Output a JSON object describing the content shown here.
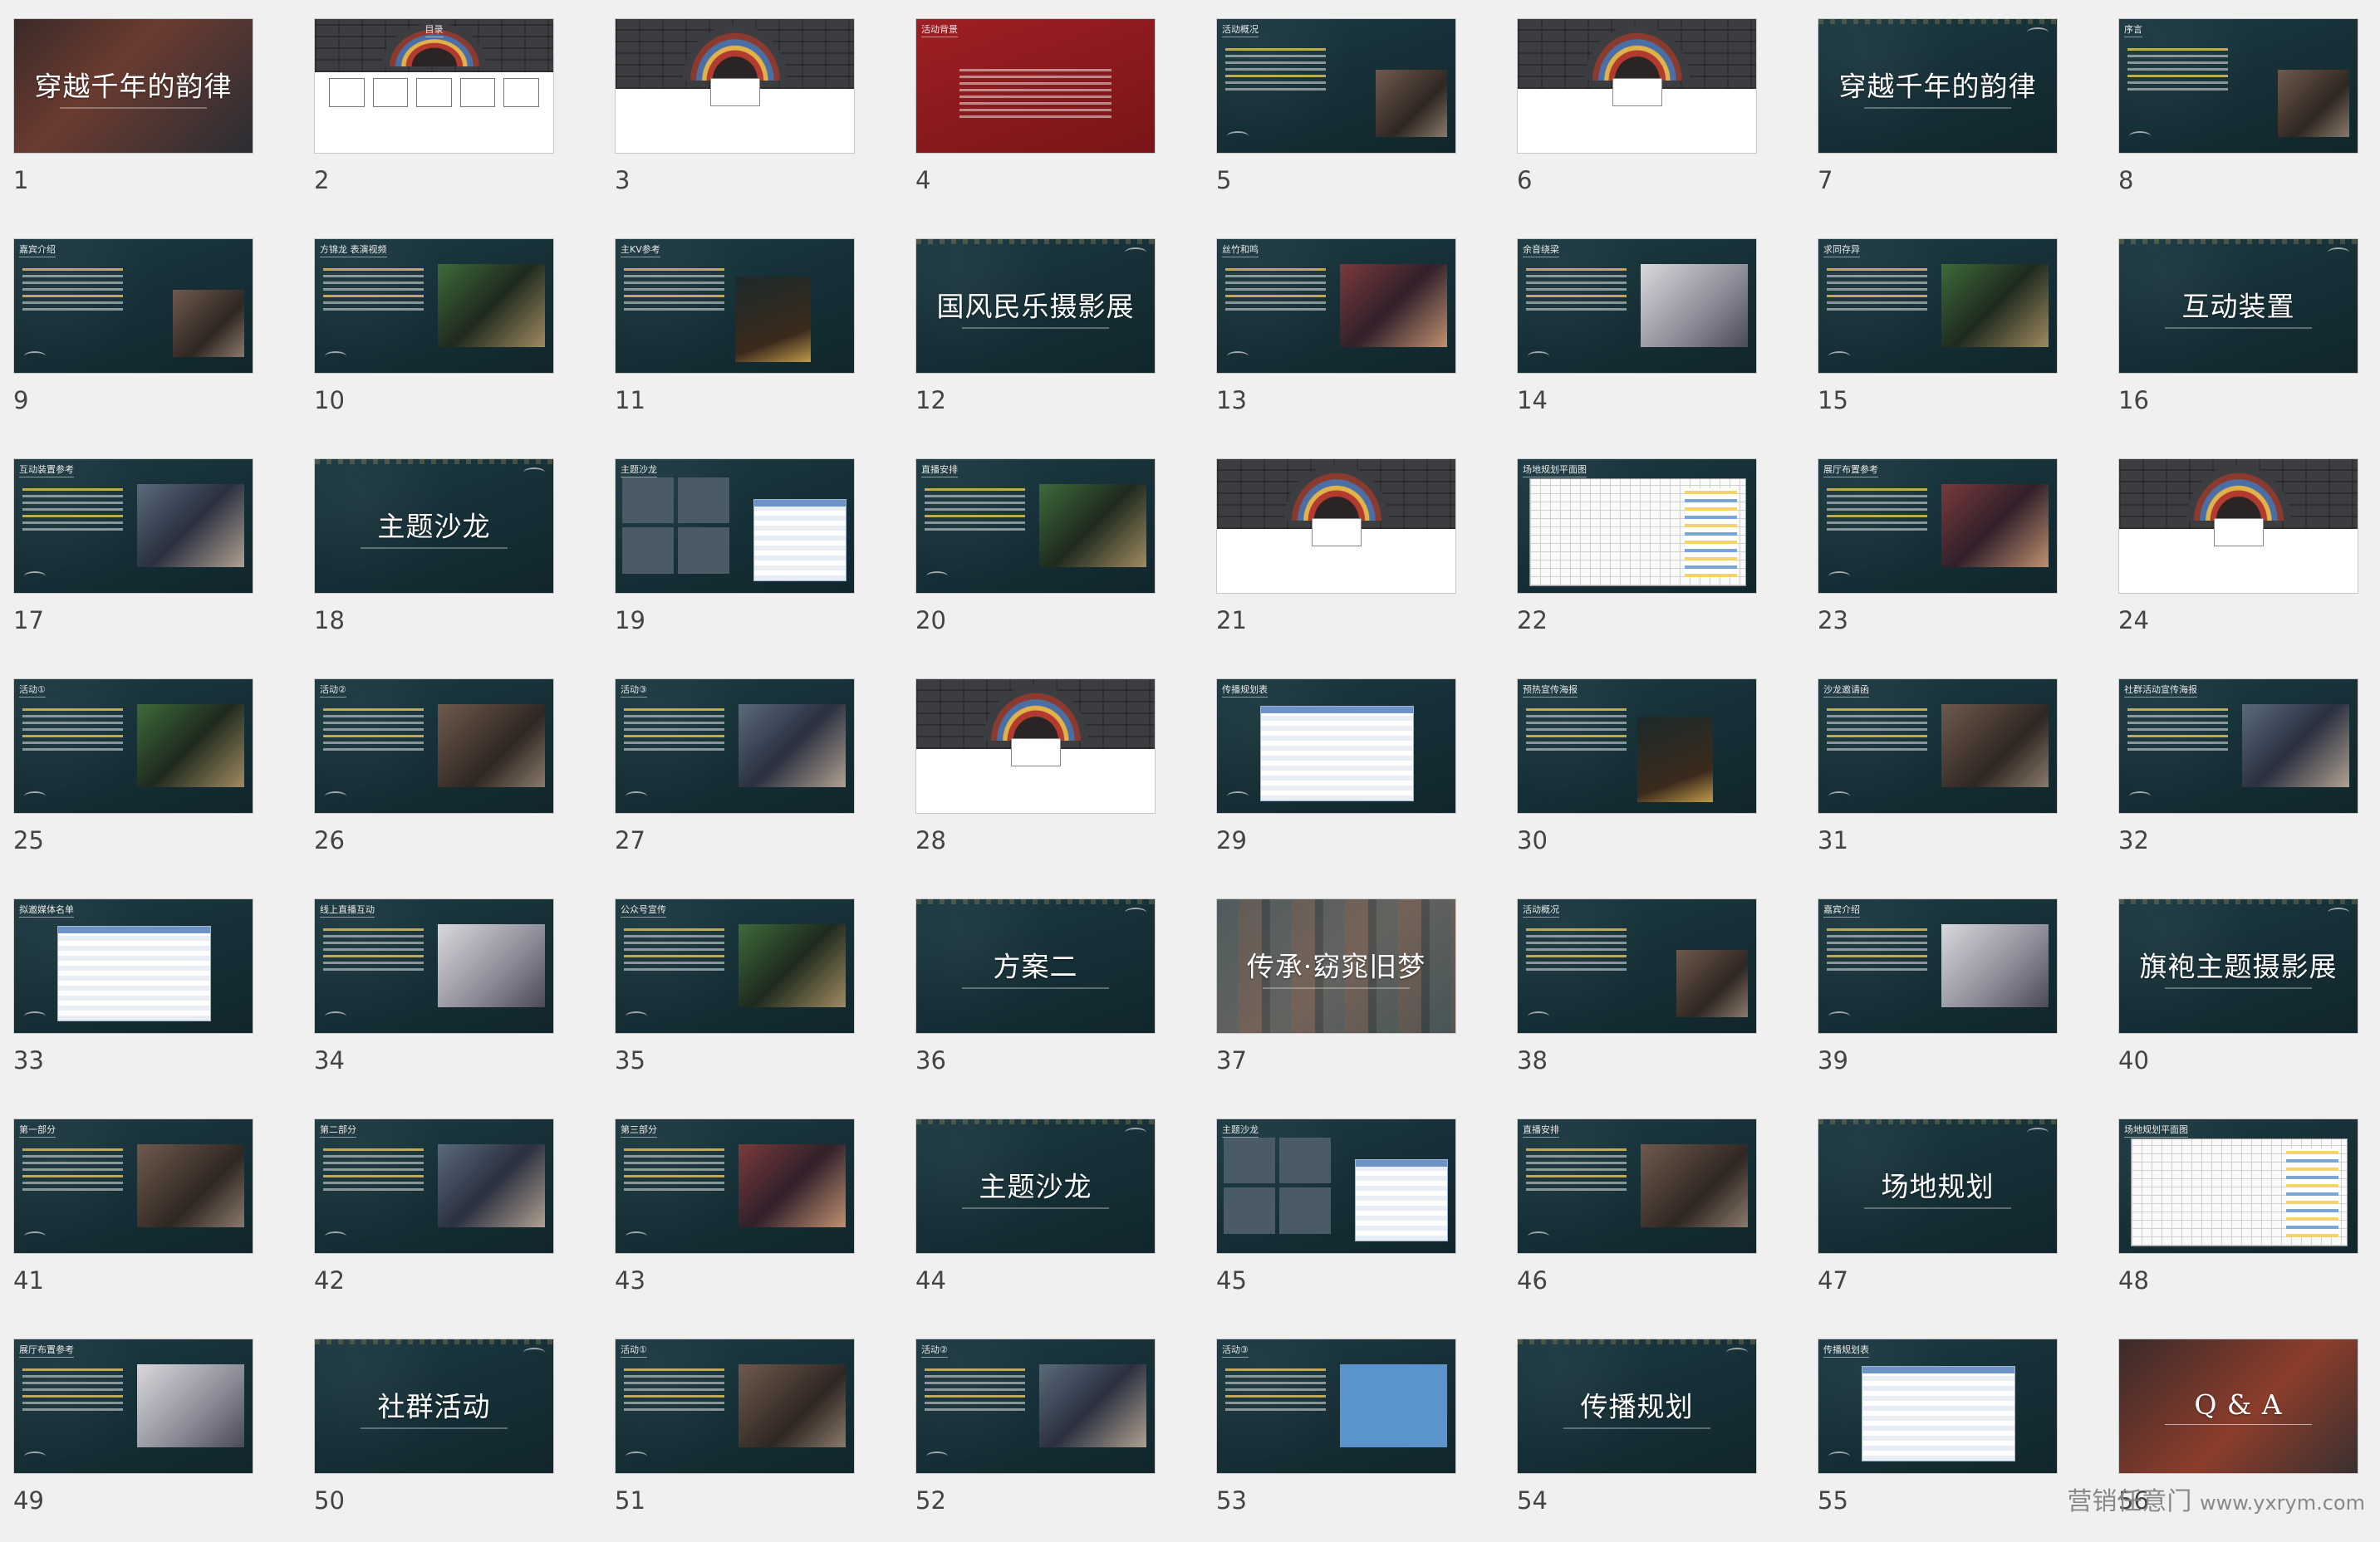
{
  "watermark": {
    "brand": "营销任意门",
    "url": "www.yxrym.com"
  },
  "slides": [
    {
      "n": "1",
      "theme": "cover",
      "title": "穿越千年的韵律"
    },
    {
      "n": "2",
      "theme": "agenda",
      "title": "目录"
    },
    {
      "n": "3",
      "theme": "divider"
    },
    {
      "n": "4",
      "theme": "red",
      "label": "活动背景"
    },
    {
      "n": "5",
      "theme": "text",
      "label": "活动概况"
    },
    {
      "n": "6",
      "theme": "divider"
    },
    {
      "n": "7",
      "theme": "title",
      "title": "穿越千年的韵律"
    },
    {
      "n": "8",
      "theme": "text",
      "label": "序言"
    },
    {
      "n": "9",
      "theme": "text",
      "label": "嘉宾介绍"
    },
    {
      "n": "10",
      "theme": "photo",
      "label": "方锦龙 表演视频"
    },
    {
      "n": "11",
      "theme": "poster",
      "label": "主KV参考"
    },
    {
      "n": "12",
      "theme": "title",
      "title": "国风民乐摄影展"
    },
    {
      "n": "13",
      "theme": "photo",
      "label": "丝竹和鸣"
    },
    {
      "n": "14",
      "theme": "photo",
      "label": "余音绕梁"
    },
    {
      "n": "15",
      "theme": "photo",
      "label": "求同存异"
    },
    {
      "n": "16",
      "theme": "title",
      "title": "互动装置"
    },
    {
      "n": "17",
      "theme": "photo",
      "label": "互动装置参考"
    },
    {
      "n": "18",
      "theme": "title",
      "title": "主题沙龙"
    },
    {
      "n": "19",
      "theme": "boxes",
      "label": "主题沙龙"
    },
    {
      "n": "20",
      "theme": "photo",
      "label": "直播安排"
    },
    {
      "n": "21",
      "theme": "divider"
    },
    {
      "n": "22",
      "theme": "plan",
      "label": "场地规划平面图"
    },
    {
      "n": "23",
      "theme": "photo",
      "label": "展厅布置参考"
    },
    {
      "n": "24",
      "theme": "divider"
    },
    {
      "n": "25",
      "theme": "photo",
      "label": "活动①"
    },
    {
      "n": "26",
      "theme": "photo",
      "label": "活动②"
    },
    {
      "n": "27",
      "theme": "photo",
      "label": "活动③"
    },
    {
      "n": "28",
      "theme": "divider"
    },
    {
      "n": "29",
      "theme": "table",
      "label": "传播规划表"
    },
    {
      "n": "30",
      "theme": "poster",
      "label": "预热宣传海报"
    },
    {
      "n": "31",
      "theme": "photo",
      "label": "沙龙邀请函"
    },
    {
      "n": "32",
      "theme": "photo",
      "label": "社群活动宣传海报"
    },
    {
      "n": "33",
      "theme": "table",
      "label": "拟邀媒体名单"
    },
    {
      "n": "34",
      "theme": "photo",
      "label": "线上直播互动"
    },
    {
      "n": "35",
      "theme": "photo",
      "label": "公众号宣传"
    },
    {
      "n": "36",
      "theme": "title",
      "title": "方案二"
    },
    {
      "n": "37",
      "theme": "qipao",
      "title": "传承·窈窕旧梦"
    },
    {
      "n": "38",
      "theme": "text",
      "label": "活动概况"
    },
    {
      "n": "39",
      "theme": "photo",
      "label": "嘉宾介绍"
    },
    {
      "n": "40",
      "theme": "title",
      "title": "旗袍主题摄影展"
    },
    {
      "n": "41",
      "theme": "photo",
      "label": "第一部分"
    },
    {
      "n": "42",
      "theme": "photo",
      "label": "第二部分"
    },
    {
      "n": "43",
      "theme": "photo",
      "label": "第三部分"
    },
    {
      "n": "44",
      "theme": "title",
      "title": "主题沙龙"
    },
    {
      "n": "45",
      "theme": "boxes",
      "label": "主题沙龙"
    },
    {
      "n": "46",
      "theme": "photo",
      "label": "直播安排"
    },
    {
      "n": "47",
      "theme": "title",
      "title": "场地规划"
    },
    {
      "n": "48",
      "theme": "plan",
      "label": "场地规划平面图"
    },
    {
      "n": "49",
      "theme": "photo",
      "label": "展厅布置参考"
    },
    {
      "n": "50",
      "theme": "title",
      "title": "社群活动"
    },
    {
      "n": "51",
      "theme": "photo",
      "label": "活动①"
    },
    {
      "n": "52",
      "theme": "photo",
      "label": "活动②"
    },
    {
      "n": "53",
      "theme": "blue",
      "label": "活动③"
    },
    {
      "n": "54",
      "theme": "title",
      "title": "传播规划"
    },
    {
      "n": "55",
      "theme": "table",
      "label": "传播规划表"
    },
    {
      "n": "56",
      "theme": "qa",
      "title": "Q & A"
    }
  ]
}
